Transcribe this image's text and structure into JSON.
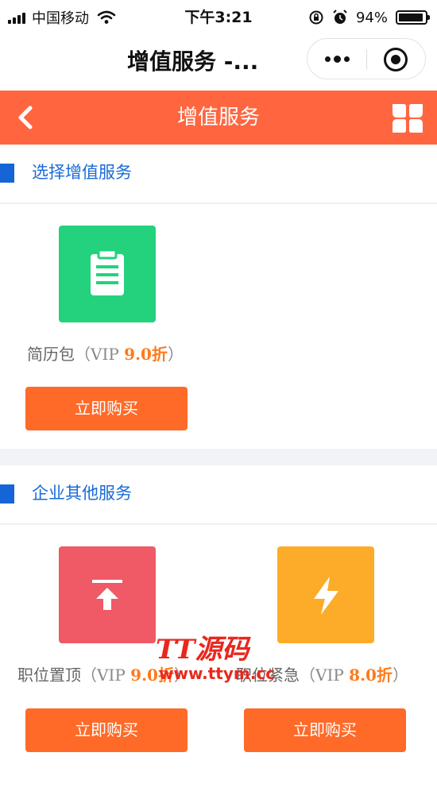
{
  "status_bar": {
    "carrier": "中国移动",
    "time": "下午3:21",
    "battery": "94%",
    "battery_level": 0.94
  },
  "nav_bar": {
    "title": "增值服务 -..."
  },
  "header": {
    "title": "增值服务"
  },
  "sections": [
    {
      "title": "选择增值服务",
      "items": [
        {
          "name": "简历包",
          "vip_prefix": "（VIP ",
          "discount": "9.0折",
          "suffix": "）",
          "button": "立即购买",
          "color": "#24d27e",
          "icon": "clipboard-icon"
        }
      ]
    },
    {
      "title": "企业其他服务",
      "items": [
        {
          "name": "职位置顶",
          "vip_prefix": "（VIP ",
          "discount": "9.0折",
          "suffix": "）",
          "button": "立即购买",
          "color": "#ef5a66",
          "icon": "pin-top-icon"
        },
        {
          "name": "职位紧急",
          "vip_prefix": "（VIP ",
          "discount": "8.0折",
          "suffix": "）",
          "button": "立即购买",
          "color": "#fdac29",
          "icon": "lightning-icon"
        }
      ]
    }
  ],
  "watermark": {
    "main": "TT源码",
    "url": "www.ttym.cc"
  }
}
